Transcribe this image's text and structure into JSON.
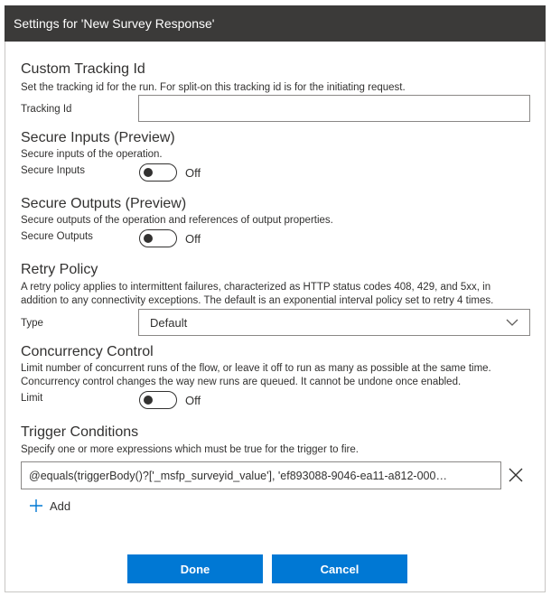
{
  "dialog": {
    "title": "Settings for 'New Survey Response'"
  },
  "tracking": {
    "title": "Custom Tracking Id",
    "description": "Set the tracking id for the run. For split-on this tracking id is for the initiating request.",
    "label": "Tracking Id",
    "value": ""
  },
  "secure_inputs": {
    "title": "Secure Inputs (Preview)",
    "description": "Secure inputs of the operation.",
    "label": "Secure Inputs",
    "state": "Off"
  },
  "secure_outputs": {
    "title": "Secure Outputs (Preview)",
    "description": "Secure outputs of the operation and references of output properties.",
    "label": "Secure Outputs",
    "state": "Off"
  },
  "retry": {
    "title": "Retry Policy",
    "description_line1": "A retry policy applies to intermittent failures, characterized as HTTP status codes 408, 429, and 5xx, in",
    "description_line2": "addition to any connectivity exceptions. The default is an exponential interval policy set to retry 4 times.",
    "label": "Type",
    "selected": "Default"
  },
  "concurrency": {
    "title": "Concurrency Control",
    "description_line1": "Limit number of concurrent runs of the flow, or leave it off to run as many as possible at the same time.",
    "description_line2": "Concurrency control changes the way new runs are queued. It cannot be undone once enabled.",
    "label": "Limit",
    "state": "Off"
  },
  "trigger": {
    "title": "Trigger Conditions",
    "description": "Specify one or more expressions which must be true for the trigger to fire.",
    "condition": "@equals(triggerBody()?['_msfp_surveyid_value'], 'ef893088-9046-ea11-a812-000…",
    "add_label": "Add"
  },
  "footer": {
    "done_label": "Done",
    "cancel_label": "Cancel"
  },
  "colors": {
    "header_bg": "#3b3a39",
    "primary": "#0078d4",
    "border": "#8a8886"
  }
}
